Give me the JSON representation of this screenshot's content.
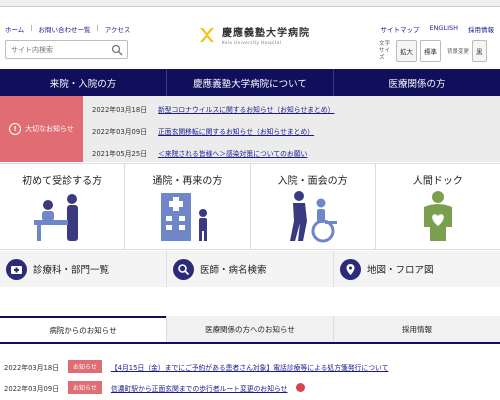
{
  "utility_links": [
    "ホーム",
    "お問い合わせ一覧",
    "アクセス"
  ],
  "right_links": [
    "サイトマップ",
    "ENGLISH",
    "採用情報"
  ],
  "search": {
    "placeholder": "サイト内検索"
  },
  "logo": {
    "name": "慶應義塾大学病院",
    "sub": "Keio University Hospital"
  },
  "font_size": {
    "label_line1": "文字",
    "label_line2": "サイズ",
    "enlarge": "拡大",
    "standard": "標準"
  },
  "color_change": {
    "label": "背景変更",
    "option": "黒"
  },
  "global_nav": [
    "来院・入院の方",
    "慶應義塾大学病院について",
    "医療関係の方"
  ],
  "important_notice": {
    "label": "大切なお知らせ",
    "items": [
      {
        "date": "2022年03月18日",
        "text": "新型コロナウイルスに関するお知らせ（お知らせまとめ）"
      },
      {
        "date": "2022年03月09日",
        "text": "正面玄関移転に関するお知らせ（お知らせまとめ）"
      },
      {
        "date": "2021年05月25日",
        "text": "＜来院される皆様へ＞感染対策についてのお願い"
      }
    ]
  },
  "tiles": [
    {
      "title": "初めて受診する方",
      "icon": "reception-desk-icon"
    },
    {
      "title": "通院・再来の方",
      "icon": "hospital-building-icon"
    },
    {
      "title": "入院・面会の方",
      "icon": "wheelchair-visit-icon"
    },
    {
      "title": "人間ドック",
      "icon": "heart-checkup-icon"
    }
  ],
  "quick_links": [
    {
      "label": "診療科・部門一覧",
      "icon": "medical-kit-icon"
    },
    {
      "label": "医師・病名検索",
      "icon": "search-icon"
    },
    {
      "label": "地図・フロア図",
      "icon": "map-pin-icon"
    }
  ],
  "tabs": [
    "病院からのお知らせ",
    "医療関係の方へのお知らせ",
    "採用情報"
  ],
  "news": [
    {
      "date": "2022年03月18日",
      "badge": "お知らせ",
      "text": "【4月15日（金）までにご予約がある患者さん対象】電話診療等による処方箋発行について"
    },
    {
      "date": "2022年03月09日",
      "badge": "お知らせ",
      "text": "信濃町駅から正面玄関までの歩行者ルート変更のお知らせ"
    }
  ],
  "colors": {
    "navy": "#0f0f5c",
    "accent_red": "#e06d73",
    "tile_icon_blue": "#6f86c8",
    "tile_icon_green": "#7aa04f"
  }
}
